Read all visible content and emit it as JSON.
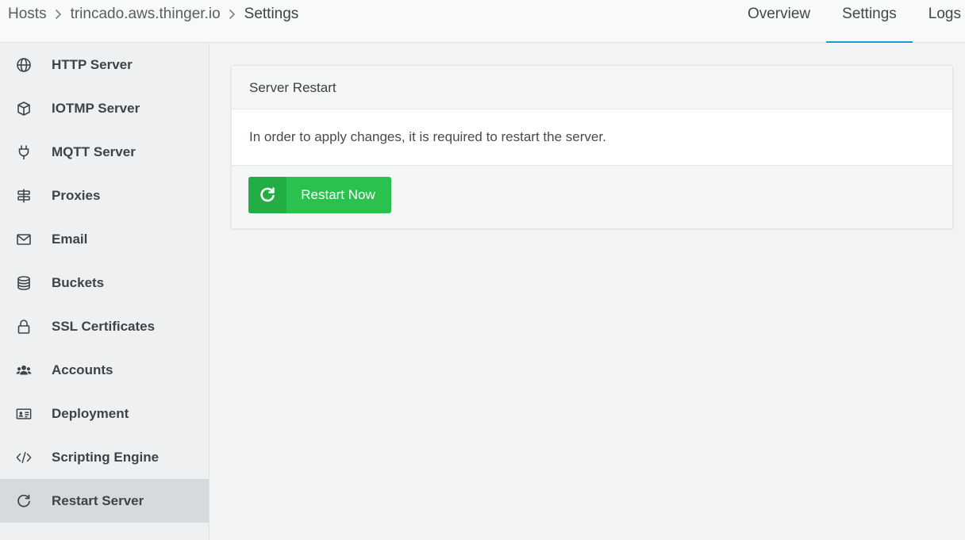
{
  "breadcrumb": {
    "items": [
      "Hosts",
      "trincado.aws.thinger.io",
      "Settings"
    ]
  },
  "tabs": [
    {
      "label": "Overview",
      "active": false
    },
    {
      "label": "Settings",
      "active": true
    },
    {
      "label": "Logs",
      "active": false
    }
  ],
  "sidebar": {
    "items": [
      {
        "label": "HTTP Server",
        "icon": "globe-icon"
      },
      {
        "label": "IOTMP Server",
        "icon": "cube-icon"
      },
      {
        "label": "MQTT Server",
        "icon": "plug-icon"
      },
      {
        "label": "Proxies",
        "icon": "signpost-icon"
      },
      {
        "label": "Email",
        "icon": "envelope-icon"
      },
      {
        "label": "Buckets",
        "icon": "database-icon"
      },
      {
        "label": "SSL Certificates",
        "icon": "lock-icon"
      },
      {
        "label": "Accounts",
        "icon": "users-icon"
      },
      {
        "label": "Deployment",
        "icon": "id-card-icon"
      },
      {
        "label": "Scripting Engine",
        "icon": "code-icon"
      },
      {
        "label": "Restart Server",
        "icon": "redo-icon",
        "active": true
      }
    ]
  },
  "card": {
    "title": "Server Restart",
    "message": "In order to apply changes, it is required to restart the server.",
    "button_label": "Restart Now"
  },
  "colors": {
    "accent_tab": "#1a9bd6",
    "button_green": "#2ac14f",
    "button_icon_green": "#22ad45"
  }
}
